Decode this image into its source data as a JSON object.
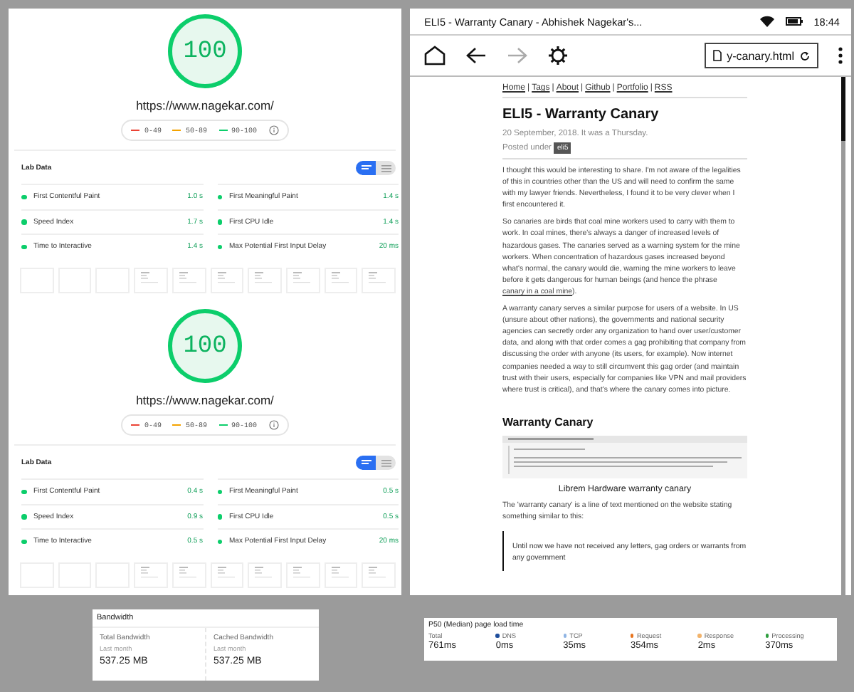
{
  "reports": [
    {
      "score": "100",
      "url": "https://www.nagekar.com/",
      "legend": [
        {
          "label": "0-49",
          "color": "#eb4335"
        },
        {
          "label": "50-89",
          "color": "#f4a300"
        },
        {
          "label": "90-100",
          "color": "#0cce6b"
        }
      ],
      "section_title": "Lab Data",
      "view_toggle": [
        {
          "kind": "summary",
          "selected": true
        },
        {
          "kind": "list",
          "selected": false
        }
      ],
      "metrics": [
        {
          "label": "First Contentful Paint",
          "value": "1.0 s"
        },
        {
          "label": "First Meaningful Paint",
          "value": "1.4 s"
        },
        {
          "label": "Speed Index",
          "value": "1.7 s"
        },
        {
          "label": "First CPU Idle",
          "value": "1.4 s"
        },
        {
          "label": "Time to Interactive",
          "value": "1.4 s"
        },
        {
          "label": "Max Potential First Input Delay",
          "value": "20 ms"
        }
      ],
      "filmstrip": [
        {
          "blank": true
        },
        {
          "blank": true
        },
        {
          "blank": true
        },
        {
          "blank": false
        },
        {
          "blank": false
        },
        {
          "blank": false
        },
        {
          "blank": false
        },
        {
          "blank": false
        },
        {
          "blank": false
        },
        {
          "blank": false
        }
      ]
    },
    {
      "score": "100",
      "url": "https://www.nagekar.com/",
      "legend": [
        {
          "label": "0-49",
          "color": "#eb4335"
        },
        {
          "label": "50-89",
          "color": "#f4a300"
        },
        {
          "label": "90-100",
          "color": "#0cce6b"
        }
      ],
      "section_title": "Lab Data",
      "view_toggle": [
        {
          "kind": "summary",
          "selected": true
        },
        {
          "kind": "list",
          "selected": false
        }
      ],
      "metrics": [
        {
          "label": "First Contentful Paint",
          "value": "0.4 s"
        },
        {
          "label": "First Meaningful Paint",
          "value": "0.5 s"
        },
        {
          "label": "Speed Index",
          "value": "0.9 s"
        },
        {
          "label": "First CPU Idle",
          "value": "0.5 s"
        },
        {
          "label": "Time to Interactive",
          "value": "0.5 s"
        },
        {
          "label": "Max Potential First Input Delay",
          "value": "20 ms"
        }
      ],
      "filmstrip": [
        {
          "blank": true
        },
        {
          "blank": true
        },
        {
          "blank": true
        },
        {
          "blank": false
        },
        {
          "blank": false
        },
        {
          "blank": false
        },
        {
          "blank": false
        },
        {
          "blank": false
        },
        {
          "blank": false
        },
        {
          "blank": false
        }
      ]
    }
  ],
  "reader": {
    "status_bar": {
      "title": "ELI5 - Warranty Canary - Abhishek Nagekar's...",
      "time": "18:44"
    },
    "toolbar": {
      "forward_disabled": true,
      "url": "y-canary.html"
    },
    "nav_links": [
      "Home",
      "Tags",
      "About",
      "Github",
      "Portfolio",
      "RSS"
    ],
    "nav_separator": "|",
    "title": "ELI5 - Warranty Canary",
    "date": "20 September, 2018. It was a Thursday.",
    "posted_under": "Posted under",
    "tag": "eli5",
    "paragraphs": [
      {
        "text": "I thought this would be interesting to share. I'm not aware of the legalities of this in countries other than the US and will need to confirm the same with my lawyer friends. Nevertheless, I found it to be very clever when I first encountered it."
      },
      {
        "text": "So canaries are birds that coal mine workers used to carry with them to work. In coal mines, there's always a danger of increased levels of hazardous gases. The canaries served as a warning system for the mine workers. When concentration of hazardous gases increased beyond what's normal, the canary would die, warning the mine workers to leave before it gets dangerous for human beings (and hence the phrase ",
        "link": "canary in a coal mine",
        "link_after": ")."
      },
      {
        "text": "A warranty canary serves a similar purpose for users of a website. In US (unsure about other nations), the governments and national security agencies can secretly order any organization to hand over user/customer data, and along with that order comes a gag prohibiting that company from discussing the order with anyone (its users, for example). Now internet companies needed a way to still circumvent this gag order (and maintain trust with their users, especially for companies like VPN and mail providers where trust is critical), and that's where the canary comes into picture."
      }
    ],
    "heading": "Warranty Canary",
    "caption": "Librem Hardware warranty canary",
    "after_text": "The 'warranty canary' is a line of text mentioned on the website stating something similar to this:",
    "quote": "Until now we have not received any letters, gag orders or warrants from any government"
  },
  "bandwidth": {
    "title": "Bandwidth",
    "items": [
      {
        "label": "Total Bandwidth",
        "period": "Last month",
        "value": "537.25 MB"
      },
      {
        "label": "Cached Bandwidth",
        "period": "Last month",
        "value": "537.25 MB"
      }
    ]
  },
  "load_time": {
    "title": "P50 (Median) page load time",
    "items": [
      {
        "label": "Total",
        "value": "761ms"
      },
      {
        "label": "DNS",
        "value": "0ms",
        "color": "#1f4e9c"
      },
      {
        "label": "TCP",
        "value": "35ms",
        "color": "#8fb4e3"
      },
      {
        "label": "Request",
        "value": "354ms",
        "color": "#e8741e"
      },
      {
        "label": "Response",
        "value": "2ms",
        "color": "#f2b36b"
      },
      {
        "label": "Processing",
        "value": "370ms",
        "color": "#2e9e3e"
      }
    ]
  }
}
